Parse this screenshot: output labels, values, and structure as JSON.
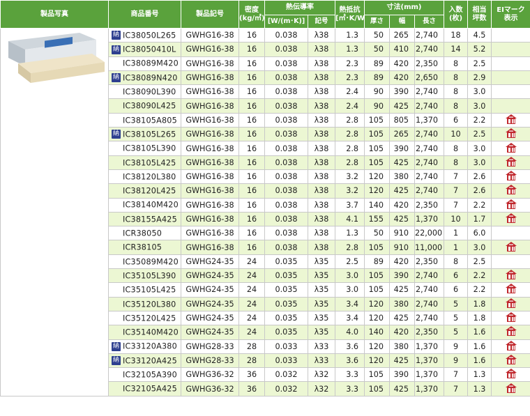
{
  "header": {
    "photo": "製品写真",
    "code": "商品番号",
    "symbol": "製品記号",
    "density": "密度",
    "density_unit": "(kg/㎥)",
    "conductivity": "熱伝導率",
    "conductivity_unit": "[W/(m･K)]",
    "conductivity_symbol": "記号",
    "resistance": "熱抵抗",
    "resistance_unit": "[㎡･K/W]",
    "dimensions": "寸法(mm)",
    "thickness": "厚さ",
    "width": "幅",
    "length": "長さ",
    "pieces": "入数",
    "pieces_unit": "(枚)",
    "tsubo": "相当",
    "tsubo_unit": "坪数",
    "ei_mark": "EIマーク",
    "ei_mark_unit": "表示"
  },
  "badge_label": "納",
  "ei_icon_name": "ei-mark-house-icon",
  "colors": {
    "header_green": "#5aa23c",
    "row_tint": "#ecf7d3",
    "badge_navy": "#2e3f8f",
    "ei_red": "#c0282d"
  },
  "rows": [
    {
      "code": "IC38050L265",
      "symbol": "GWHG16-38",
      "density": "16",
      "cond": "0.038",
      "lam": "λ38",
      "res": "1.3",
      "t": "50",
      "w": "265",
      "l": "2,740",
      "pcs": "18",
      "tsubo": "4.5",
      "badge": true,
      "ei": false
    },
    {
      "code": "IC38050410L",
      "symbol": "GWHG16-38",
      "density": "16",
      "cond": "0.038",
      "lam": "λ38",
      "res": "1.3",
      "t": "50",
      "w": "410",
      "l": "2,740",
      "pcs": "14",
      "tsubo": "5.2",
      "badge": true,
      "ei": false
    },
    {
      "code": "IC38089M420",
      "symbol": "GWHG16-38",
      "density": "16",
      "cond": "0.038",
      "lam": "λ38",
      "res": "2.3",
      "t": "89",
      "w": "420",
      "l": "2,350",
      "pcs": "8",
      "tsubo": "2.5",
      "badge": false,
      "ei": false
    },
    {
      "code": "IC38089N420",
      "symbol": "GWHG16-38",
      "density": "16",
      "cond": "0.038",
      "lam": "λ38",
      "res": "2.3",
      "t": "89",
      "w": "420",
      "l": "2,650",
      "pcs": "8",
      "tsubo": "2.9",
      "badge": true,
      "ei": false
    },
    {
      "code": "IC38090L390",
      "symbol": "GWHG16-38",
      "density": "16",
      "cond": "0.038",
      "lam": "λ38",
      "res": "2.4",
      "t": "90",
      "w": "390",
      "l": "2,740",
      "pcs": "8",
      "tsubo": "3.0",
      "badge": false,
      "ei": false
    },
    {
      "code": "IC38090L425",
      "symbol": "GWHG16-38",
      "density": "16",
      "cond": "0.038",
      "lam": "λ38",
      "res": "2.4",
      "t": "90",
      "w": "425",
      "l": "2,740",
      "pcs": "8",
      "tsubo": "3.0",
      "badge": false,
      "ei": false
    },
    {
      "code": "IC38105A805",
      "symbol": "GWHG16-38",
      "density": "16",
      "cond": "0.038",
      "lam": "λ38",
      "res": "2.8",
      "t": "105",
      "w": "805",
      "l": "1,370",
      "pcs": "6",
      "tsubo": "2.2",
      "badge": false,
      "ei": true
    },
    {
      "code": "IC38105L265",
      "symbol": "GWHG16-38",
      "density": "16",
      "cond": "0.038",
      "lam": "λ38",
      "res": "2.8",
      "t": "105",
      "w": "265",
      "l": "2,740",
      "pcs": "10",
      "tsubo": "2.5",
      "badge": true,
      "ei": true
    },
    {
      "code": "IC38105L390",
      "symbol": "GWHG16-38",
      "density": "16",
      "cond": "0.038",
      "lam": "λ38",
      "res": "2.8",
      "t": "105",
      "w": "390",
      "l": "2,740",
      "pcs": "8",
      "tsubo": "3.0",
      "badge": false,
      "ei": true
    },
    {
      "code": "IC38105L425",
      "symbol": "GWHG16-38",
      "density": "16",
      "cond": "0.038",
      "lam": "λ38",
      "res": "2.8",
      "t": "105",
      "w": "425",
      "l": "2,740",
      "pcs": "8",
      "tsubo": "3.0",
      "badge": false,
      "ei": true
    },
    {
      "code": "IC38120L380",
      "symbol": "GWHG16-38",
      "density": "16",
      "cond": "0.038",
      "lam": "λ38",
      "res": "3.2",
      "t": "120",
      "w": "380",
      "l": "2,740",
      "pcs": "7",
      "tsubo": "2.6",
      "badge": false,
      "ei": true
    },
    {
      "code": "IC38120L425",
      "symbol": "GWHG16-38",
      "density": "16",
      "cond": "0.038",
      "lam": "λ38",
      "res": "3.2",
      "t": "120",
      "w": "425",
      "l": "2,740",
      "pcs": "7",
      "tsubo": "2.6",
      "badge": false,
      "ei": true
    },
    {
      "code": "IC38140M420",
      "symbol": "GWHG16-38",
      "density": "16",
      "cond": "0.038",
      "lam": "λ38",
      "res": "3.7",
      "t": "140",
      "w": "420",
      "l": "2,350",
      "pcs": "7",
      "tsubo": "2.2",
      "badge": false,
      "ei": true
    },
    {
      "code": "IC38155A425",
      "symbol": "GWHG16-38",
      "density": "16",
      "cond": "0.038",
      "lam": "λ38",
      "res": "4.1",
      "t": "155",
      "w": "425",
      "l": "1,370",
      "pcs": "10",
      "tsubo": "1.7",
      "badge": false,
      "ei": true
    },
    {
      "code": "ICR38050",
      "symbol": "GWHG16-38",
      "density": "16",
      "cond": "0.038",
      "lam": "λ38",
      "res": "1.3",
      "t": "50",
      "w": "910",
      "l": "22,000",
      "pcs": "1",
      "tsubo": "6.0",
      "badge": false,
      "ei": false
    },
    {
      "code": "ICR38105",
      "symbol": "GWHG16-38",
      "density": "16",
      "cond": "0.038",
      "lam": "λ38",
      "res": "2.8",
      "t": "105",
      "w": "910",
      "l": "11,000",
      "pcs": "1",
      "tsubo": "3.0",
      "badge": false,
      "ei": true
    },
    {
      "code": "IC35089M420",
      "symbol": "GWHG24-35",
      "density": "24",
      "cond": "0.035",
      "lam": "λ35",
      "res": "2.5",
      "t": "89",
      "w": "420",
      "l": "2,350",
      "pcs": "8",
      "tsubo": "2.5",
      "badge": false,
      "ei": false
    },
    {
      "code": "IC35105L390",
      "symbol": "GWHG24-35",
      "density": "24",
      "cond": "0.035",
      "lam": "λ35",
      "res": "3.0",
      "t": "105",
      "w": "390",
      "l": "2,740",
      "pcs": "6",
      "tsubo": "2.2",
      "badge": false,
      "ei": true
    },
    {
      "code": "IC35105L425",
      "symbol": "GWHG24-35",
      "density": "24",
      "cond": "0.035",
      "lam": "λ35",
      "res": "3.0",
      "t": "105",
      "w": "425",
      "l": "2,740",
      "pcs": "6",
      "tsubo": "2.2",
      "badge": false,
      "ei": true
    },
    {
      "code": "IC35120L380",
      "symbol": "GWHG24-35",
      "density": "24",
      "cond": "0.035",
      "lam": "λ35",
      "res": "3.4",
      "t": "120",
      "w": "380",
      "l": "2,740",
      "pcs": "5",
      "tsubo": "1.8",
      "badge": false,
      "ei": true
    },
    {
      "code": "IC35120L425",
      "symbol": "GWHG24-35",
      "density": "24",
      "cond": "0.035",
      "lam": "λ35",
      "res": "3.4",
      "t": "120",
      "w": "425",
      "l": "2,740",
      "pcs": "5",
      "tsubo": "1.8",
      "badge": false,
      "ei": true
    },
    {
      "code": "IC35140M420",
      "symbol": "GWHG24-35",
      "density": "24",
      "cond": "0.035",
      "lam": "λ35",
      "res": "4.0",
      "t": "140",
      "w": "420",
      "l": "2,350",
      "pcs": "5",
      "tsubo": "1.6",
      "badge": false,
      "ei": true
    },
    {
      "code": "IC33120A380",
      "symbol": "GWHG28-33",
      "density": "28",
      "cond": "0.033",
      "lam": "λ33",
      "res": "3.6",
      "t": "120",
      "w": "380",
      "l": "1,370",
      "pcs": "9",
      "tsubo": "1.6",
      "badge": true,
      "ei": true
    },
    {
      "code": "IC33120A425",
      "symbol": "GWHG28-33",
      "density": "28",
      "cond": "0.033",
      "lam": "λ33",
      "res": "3.6",
      "t": "120",
      "w": "425",
      "l": "1,370",
      "pcs": "9",
      "tsubo": "1.6",
      "badge": true,
      "ei": true
    },
    {
      "code": "IC32105A390",
      "symbol": "GWHG36-32",
      "density": "36",
      "cond": "0.032",
      "lam": "λ32",
      "res": "3.3",
      "t": "105",
      "w": "390",
      "l": "1,370",
      "pcs": "7",
      "tsubo": "1.3",
      "badge": false,
      "ei": true
    },
    {
      "code": "IC32105A425",
      "symbol": "GWHG36-32",
      "density": "36",
      "cond": "0.032",
      "lam": "λ32",
      "res": "3.3",
      "t": "105",
      "w": "425",
      "l": "1,370",
      "pcs": "7",
      "tsubo": "1.3",
      "badge": false,
      "ei": true
    }
  ]
}
